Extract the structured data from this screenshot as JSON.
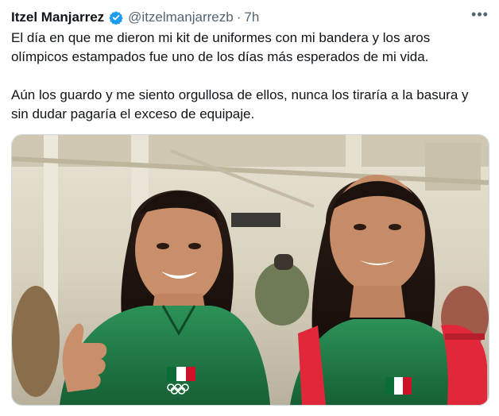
{
  "tweet": {
    "author": "Itzel Manjarrez",
    "handle": "@itzelmanjarrezb",
    "separator": "·",
    "time": "7h",
    "more_label": "•••",
    "paragraphs": [
      "El día en que me dieron mi kit de uniformes con mi bandera y los aros olímpicos estampados fue uno de los días más esperados de mi vida.",
      "Aún los guardo y me siento orgullosa de ellos, nunca los tiraría a la basura y sin dudar pagaría el exceso de equipaje."
    ]
  },
  "colors": {
    "verified": "#1d9bf0",
    "jacket": "#1f7a45",
    "backpack": "#e0283a"
  },
  "icons": [
    "verified-badge-icon",
    "more-options-icon"
  ]
}
